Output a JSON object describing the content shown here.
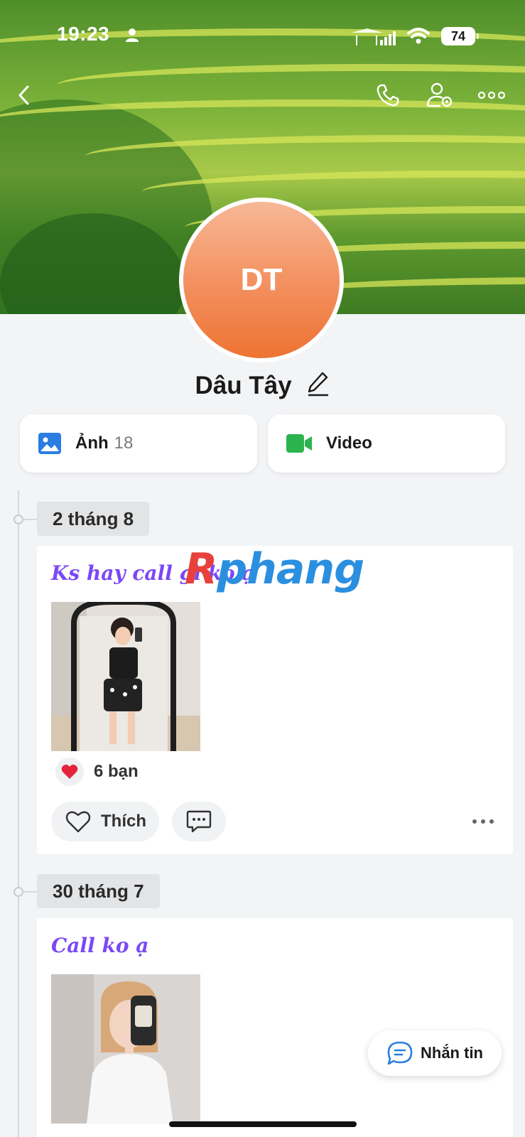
{
  "status_bar": {
    "time": "19:23",
    "battery": "74"
  },
  "profile": {
    "initials": "DT",
    "name": "Dâu Tây"
  },
  "media": {
    "photos_label": "Ảnh",
    "photos_count": "18",
    "video_label": "Video"
  },
  "posts": [
    {
      "date": "2 tháng 8",
      "text": "Ks hay call gì ko ạ",
      "reaction_count": "6 bạn",
      "like_label": "Thích"
    },
    {
      "date": "30 tháng 7",
      "text": "Call ko ạ"
    }
  ],
  "watermark": {
    "part1": "R",
    "part2": "phang"
  },
  "message_button": {
    "label": "Nhắn tin"
  },
  "colors": {
    "accent_purple": "#7b48f5",
    "avatar_orange": "#f39262",
    "photo_icon": "#2a7de1",
    "video_icon": "#2bb34f"
  }
}
